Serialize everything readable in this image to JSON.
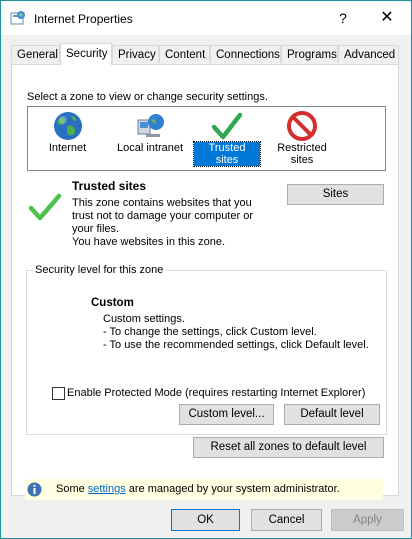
{
  "window": {
    "title": "Internet Properties",
    "help_glyph": "?",
    "close_glyph": "✕"
  },
  "tabs": [
    {
      "label": "General"
    },
    {
      "label": "Security"
    },
    {
      "label": "Privacy"
    },
    {
      "label": "Content"
    },
    {
      "label": "Connections"
    },
    {
      "label": "Programs"
    },
    {
      "label": "Advanced"
    }
  ],
  "security": {
    "zone_prompt": "Select a zone to view or change security settings.",
    "zones": [
      {
        "label": "Internet",
        "icon": "globe-icon"
      },
      {
        "label": "Local intranet",
        "icon": "intranet-icon"
      },
      {
        "label": "Trusted sites",
        "icon": "checkmark-icon"
      },
      {
        "label_line1": "Restricted",
        "label_line2": "sites",
        "icon": "restricted-icon"
      }
    ],
    "selected_zone": "Trusted sites",
    "zone_title": "Trusted sites",
    "zone_desc_1": "This zone contains websites that you",
    "zone_desc_2": "trust not to damage your computer or",
    "zone_desc_3": "your files.",
    "zone_desc_4": "You have websites in this zone.",
    "sites_button": "Sites",
    "security_level_legend": "Security level for this zone",
    "level_name": "Custom",
    "level_desc_1": "Custom settings.",
    "level_desc_2": "- To change the settings, click Custom level.",
    "level_desc_3": "- To use the recommended settings, click Default level.",
    "protected_mode_label": "Enable Protected Mode (requires restarting Internet Explorer)",
    "protected_mode_checked": false,
    "custom_level_button": "Custom level...",
    "default_level_button": "Default level",
    "reset_all_button": "Reset all zones to default level"
  },
  "info_bar": {
    "prefix": "Some ",
    "link": "settings",
    "suffix": " are managed by your system administrator."
  },
  "footer": {
    "ok": "OK",
    "cancel": "Cancel",
    "apply": "Apply"
  },
  "colors": {
    "accent": "#0078d7",
    "check_green": "#2fa84f",
    "teal_bg": "#00a2ad"
  }
}
